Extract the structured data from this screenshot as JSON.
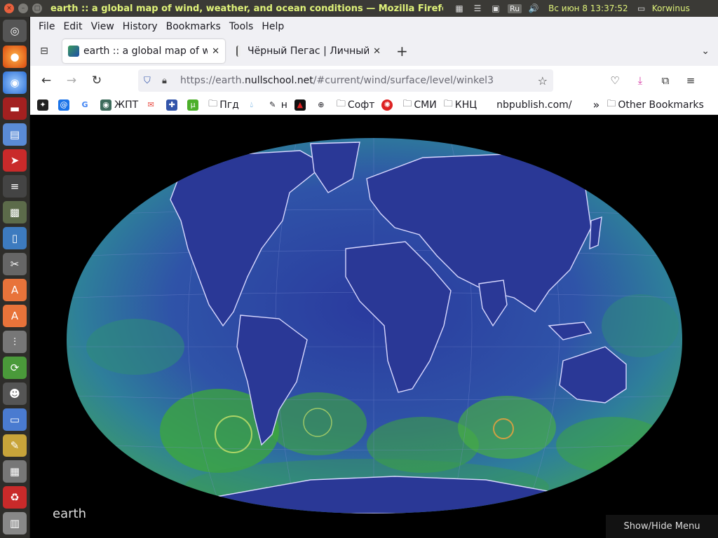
{
  "system": {
    "window_title": "earth :: a global map of wind, weather, and ocean conditions — Mozilla Firefo",
    "lang": "Ru",
    "clock": "Вс июн  8 13:37:52",
    "user": "Korwinus"
  },
  "menu": {
    "items": [
      {
        "label": "File",
        "mnemonic": "F",
        "rest": "ile"
      },
      {
        "label": "Edit",
        "mnemonic": "E",
        "rest": "dit"
      },
      {
        "label": "View",
        "mnemonic": "V",
        "rest": "iew"
      },
      {
        "label": "History",
        "mnemonic": "",
        "pre": "Hi",
        "mn": "s",
        "rest": "tory"
      },
      {
        "label": "Bookmarks",
        "mnemonic": "B",
        "rest": "ookmarks"
      },
      {
        "label": "Tools",
        "mnemonic": "T",
        "rest": "ools"
      },
      {
        "label": "Help",
        "mnemonic": "H",
        "rest": "elp"
      }
    ]
  },
  "tabs": [
    {
      "label": "earth :: a global map of wind, weather, and ocean conditions",
      "active": true
    },
    {
      "label": "Чёрный Пегас | Личный",
      "active": false
    }
  ],
  "url": {
    "prefix": "https://earth.",
    "host": "nullschool.net",
    "path": "/#current/wind/surface/level/winkel3"
  },
  "bookmarks": [
    {
      "label": "",
      "icon": "✦"
    },
    {
      "label": "",
      "icon": "@"
    },
    {
      "label": "",
      "icon": "G"
    },
    {
      "label": "ЖПТ",
      "icon": "◉"
    },
    {
      "label": "",
      "icon": "✉"
    },
    {
      "label": "",
      "icon": "✚"
    },
    {
      "label": "",
      "icon": "µ"
    },
    {
      "label": "Пгд",
      "icon": "folder"
    },
    {
      "label": "",
      "icon": "💧"
    },
    {
      "label": "н",
      "icon": "✎"
    },
    {
      "label": "",
      "icon": "▲"
    },
    {
      "label": "",
      "icon": "⊕"
    },
    {
      "label": "Софт",
      "icon": "folder"
    },
    {
      "label": "",
      "icon": "✺"
    },
    {
      "label": "СМИ",
      "icon": "folder"
    },
    {
      "label": "КНЦ",
      "icon": "folder"
    },
    {
      "label": "nbpublish.com/",
      "icon": ""
    }
  ],
  "other_bookmarks": "Other Bookmarks",
  "page": {
    "brand": "earth",
    "menu_toggle": "Show/Hide Menu"
  },
  "colors": {
    "ocean_blue": "#2a3f9e",
    "wind_green": "#3ea83a",
    "coast_white": "#d8d8ff",
    "title_green": "#dff27a"
  }
}
